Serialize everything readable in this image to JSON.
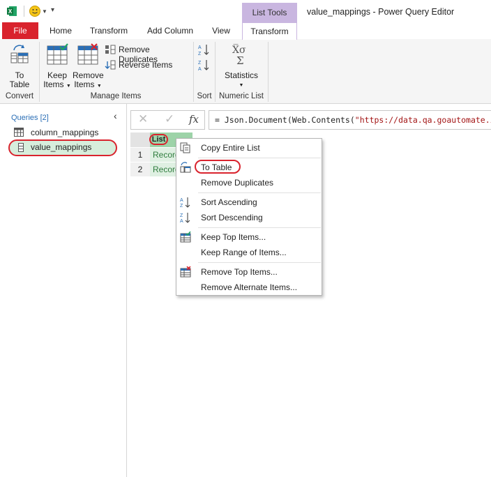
{
  "window": {
    "title": "value_mappings - Power Query Editor",
    "contextual_tab_group": "List Tools"
  },
  "tabs": {
    "file": "File",
    "home": "Home",
    "transform": "Transform",
    "add_column": "Add Column",
    "view": "View",
    "transform_active": "Transform"
  },
  "ribbon": {
    "to_table": {
      "line1": "To",
      "line2": "Table"
    },
    "keep_items": {
      "line1": "Keep",
      "line2": "Items"
    },
    "remove_items": {
      "line1": "Remove",
      "line2": "Items"
    },
    "remove_duplicates": "Remove Duplicates",
    "reverse_items": "Reverse Items",
    "statistics": "Statistics",
    "groups": {
      "convert": "Convert",
      "manage_items": "Manage Items",
      "sort": "Sort",
      "numeric_list": "Numeric List"
    }
  },
  "queries": {
    "header": "Queries [2]",
    "items": [
      {
        "name": "column_mappings"
      },
      {
        "name": "value_mappings"
      }
    ]
  },
  "formula_bar": {
    "fx_label": "fx",
    "formula_prefix": "= Json.Document(Web.Contents(",
    "formula_string": "\"https://data.qa.goautomate.io/"
  },
  "grid": {
    "column_header": "List",
    "rows": [
      {
        "num": "1",
        "value": "Record"
      },
      {
        "num": "2",
        "value": "Record"
      }
    ]
  },
  "context_menu": {
    "items": [
      "Copy Entire List",
      "To Table",
      "Remove Duplicates",
      "Sort Ascending",
      "Sort Descending",
      "Keep Top Items...",
      "Keep Range of Items...",
      "Remove Top Items...",
      "Remove Alternate Items..."
    ]
  },
  "colors": {
    "file_tab": "#d9232d",
    "contextual": "#c9b6e0",
    "highlight_ring": "#d9232d",
    "selected_query": "#d7eedc",
    "column_header": "#9dd3a8"
  }
}
